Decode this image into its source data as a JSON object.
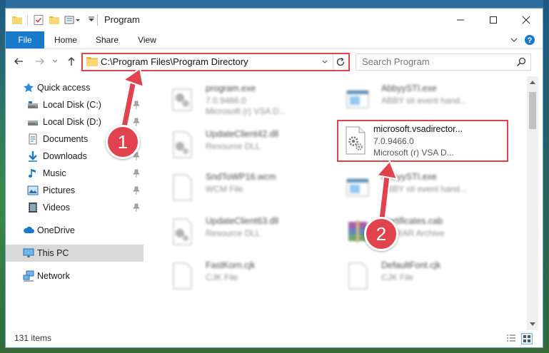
{
  "window": {
    "title": "Program",
    "accent": "#1979ca",
    "callout_color": "#e0434e"
  },
  "ribbon": {
    "tabs": [
      "File",
      "Home",
      "Share",
      "View"
    ]
  },
  "address": {
    "path": "C:\\Program Files\\Program Directory",
    "search_placeholder": "Search Program"
  },
  "sidebar": {
    "quick_access": "Quick access",
    "items": [
      {
        "label": "Local Disk (C:)",
        "icon": "drive-icon"
      },
      {
        "label": "Local Disk (D:)",
        "icon": "drive-icon"
      },
      {
        "label": "Documents",
        "icon": "documents-icon"
      },
      {
        "label": "Downloads",
        "icon": "downloads-icon"
      },
      {
        "label": "Music",
        "icon": "music-icon"
      },
      {
        "label": "Pictures",
        "icon": "pictures-icon"
      },
      {
        "label": "Videos",
        "icon": "videos-icon"
      }
    ],
    "onedrive": "OneDrive",
    "this_pc": "This PC",
    "network": "Network"
  },
  "files": [
    {
      "name": "program.exe",
      "line1": "7.0.9466.0",
      "line2": "Microsoft (r) VSA D..."
    },
    {
      "name": "AbbyySTI.exe",
      "line1": "ABBY sti event hand..."
    },
    {
      "name": "UpdateClient42.dll",
      "line1": "Resource DLL"
    },
    {
      "name": "SndToWP16.wcm",
      "line1": "WCM File"
    },
    {
      "name": "AbbyySTI.exe",
      "line1": "ABBY sti event hand..."
    },
    {
      "name": "UpdateClient63.dll",
      "line1": "Resource DLL"
    },
    {
      "name": "Certificates.cab",
      "line1": "WinRAR Archive"
    },
    {
      "name": "FastKorn.cjk",
      "line1": "CJK File"
    },
    {
      "name": "DefaultFont.cjk",
      "line1": "CJK File"
    }
  ],
  "highlighted_file": {
    "name": "microsoft.vsadirector...",
    "version": "7.0.9466.0",
    "description": "Microsoft (r) VSA D..."
  },
  "status": {
    "count": "131 items"
  },
  "callouts": [
    "1",
    "2"
  ]
}
